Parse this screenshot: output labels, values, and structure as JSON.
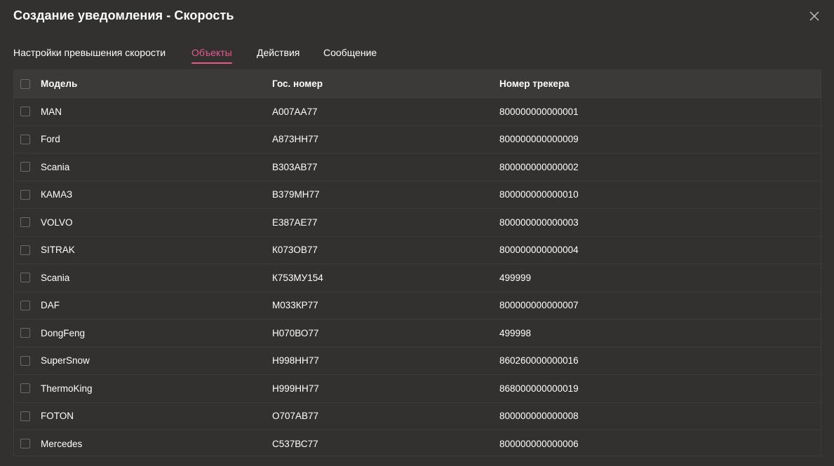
{
  "dialog": {
    "title": "Создание уведомления - Скорость"
  },
  "tabs": [
    {
      "label": "Настройки превышения скорости",
      "active": false
    },
    {
      "label": "Объекты",
      "active": true
    },
    {
      "label": "Действия",
      "active": false
    },
    {
      "label": "Сообщение",
      "active": false
    }
  ],
  "colors": {
    "accent": "#e65a8e",
    "background": "#323130",
    "header": "#3b3a39"
  },
  "table": {
    "columns": [
      "Модель",
      "Гос. номер",
      "Номер трекера"
    ],
    "rows": [
      [
        "MAN",
        "А007АА77",
        "800000000000001"
      ],
      [
        "Ford",
        "А873НН77",
        "800000000000009"
      ],
      [
        "Scania",
        "В303АВ77",
        "800000000000002"
      ],
      [
        "КАМАЗ",
        "В379МН77",
        "800000000000010"
      ],
      [
        "VOLVO",
        "Е387АЕ77",
        "800000000000003"
      ],
      [
        "SITRAK",
        "К073ОВ77",
        "800000000000004"
      ],
      [
        "Scania",
        "К753МУ154",
        "499999"
      ],
      [
        "DAF",
        "М033КР77",
        "800000000000007"
      ],
      [
        "DongFeng",
        "Н070ВО77",
        "499998"
      ],
      [
        "SuperSnow",
        "Н998НН77",
        "860260000000016"
      ],
      [
        "ThermoKing",
        "Н999НН77",
        "868000000000019"
      ],
      [
        "FOTON",
        "О707АВ77",
        "800000000000008"
      ],
      [
        "Mercedes",
        "С537ВС77",
        "800000000000006"
      ]
    ]
  }
}
